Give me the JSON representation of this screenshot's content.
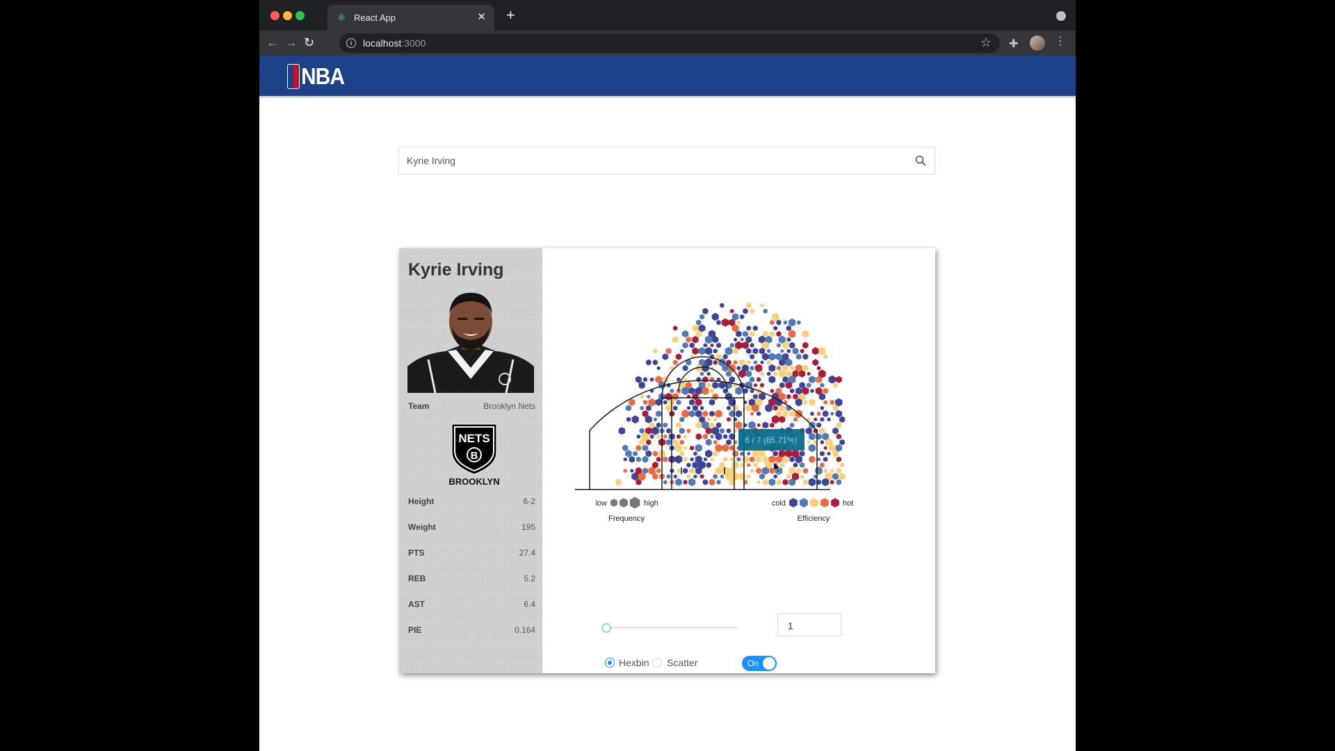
{
  "browser": {
    "tab_title": "React App",
    "url_host": "localhost",
    "url_port": ":3000"
  },
  "search": {
    "value": "Kyrie Irving"
  },
  "player": {
    "name": "Kyrie Irving",
    "team_label": "Team",
    "team_value": "Brooklyn Nets",
    "team_logo_text": "NETS",
    "team_logo_city": "BROOKLYN",
    "stats": [
      {
        "label": "Height",
        "value": "6-2"
      },
      {
        "label": "Weight",
        "value": "195"
      },
      {
        "label": "PTS",
        "value": "27.4"
      },
      {
        "label": "REB",
        "value": "5.2"
      },
      {
        "label": "AST",
        "value": "6.4"
      },
      {
        "label": "PIE",
        "value": "0.164"
      }
    ]
  },
  "chart": {
    "tooltip": "6 / 7 (85.71%)",
    "frequency_low": "low",
    "frequency_high": "high",
    "frequency_title": "Frequency",
    "efficiency_cold": "cold",
    "efficiency_hot": "hot",
    "efficiency_title": "Efficiency",
    "efficiency_colors": [
      "#3f4596",
      "#4f79b7",
      "#f8d07a",
      "#ea6a41",
      "#a81d3b"
    ],
    "frequency_color": "#777777"
  },
  "controls": {
    "min_count_value": "1",
    "slider_fraction": 0,
    "radio_hexbin": "Hexbin",
    "radio_scatter": "Scatter",
    "toggle_label": "On",
    "selected_chart_type": "Hexbin",
    "toggle_on": true
  },
  "header": {
    "logo_text": "NBA"
  }
}
